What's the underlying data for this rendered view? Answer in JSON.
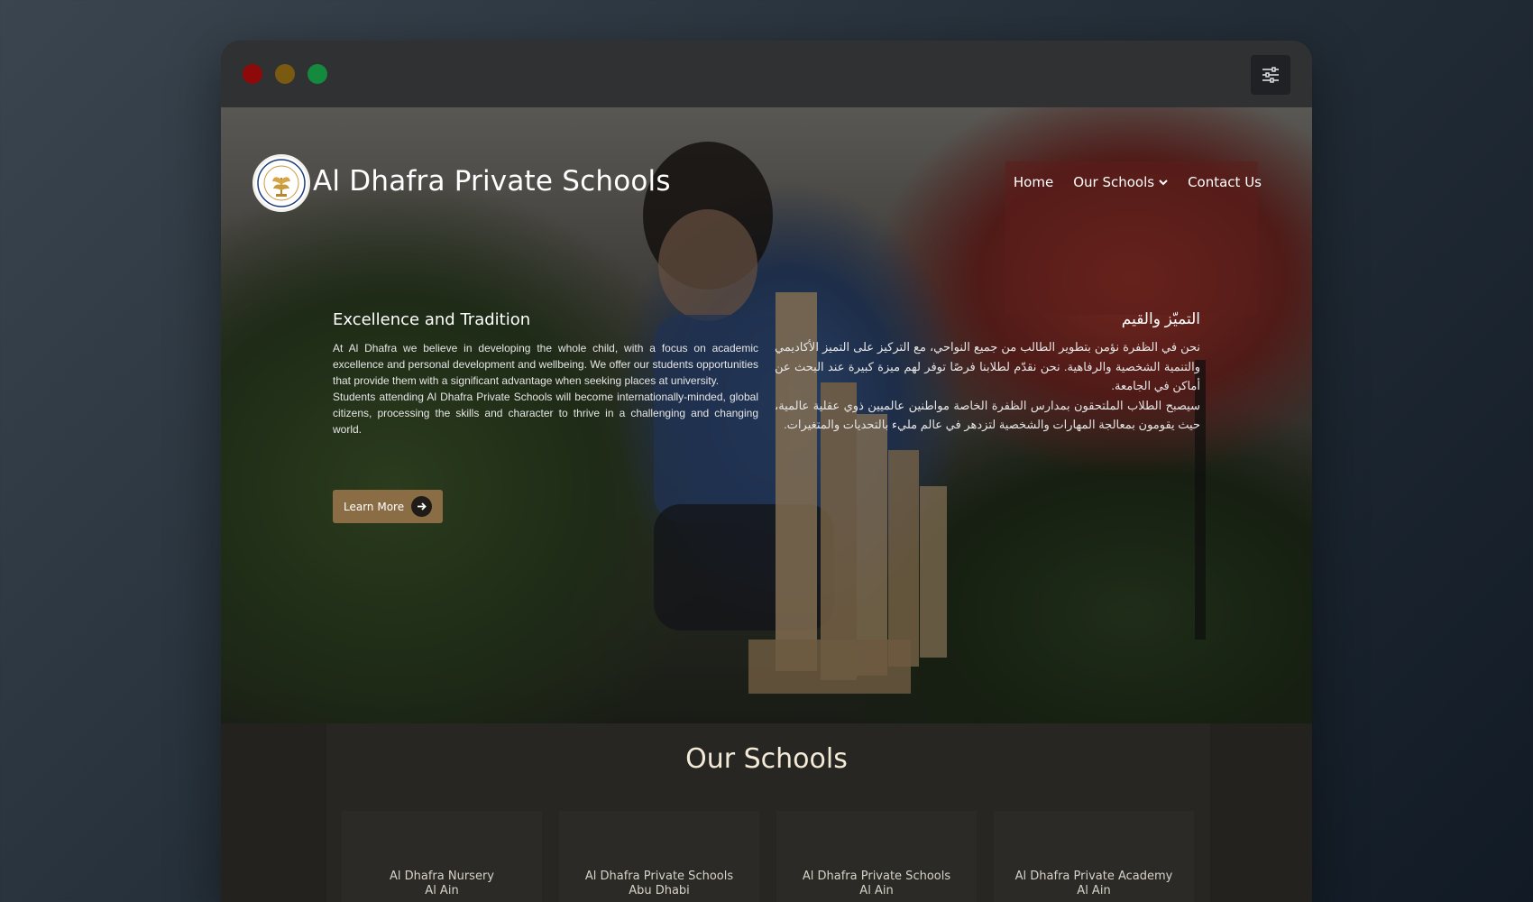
{
  "window": {
    "controls": [
      "close",
      "minimize",
      "maximize"
    ],
    "settings_icon": "sliders-icon"
  },
  "header": {
    "site_title": "Al Dhafra Private Schools",
    "logo_icon": "school-crest-logo",
    "nav": [
      {
        "label": "Home"
      },
      {
        "label": "Our Schools",
        "icon": "chevron-down-icon"
      },
      {
        "label": "Contact Us"
      }
    ]
  },
  "hero": {
    "en": {
      "heading": "Excellence and Tradition",
      "para1": "At Al Dhafra we believe in developing the whole child, with a focus on academic excellence and personal development and wellbeing. We offer our students opportunities that provide them with a significant advantage when seeking places at university.",
      "para2": "Students attending Al Dhafra Private Schools will become internationally-minded, global citizens, processing the skills and character to thrive in a challenging and changing world."
    },
    "ar": {
      "heading": "التميّز والقيم",
      "para1": "نحن في الظفرة نؤمن بتطوير الطالب من جميع النواحي، مع التركيز على التميز الأكاديمي والتنمية الشخصية والرفاهية. نحن نقدّم لطلابنا فرصًا توفر لهم ميزة كبيرة عند البحث عن أماكن في الجامعة.",
      "para2": "سيصبح الطلاب الملتحقون بمدارس الظفرة الخاصة مواطنين عالميين ذوي عقلية عالمية، حيث يقومون بمعالجة المهارات والشخصية لتزدهر في عالم مليء بالتحديات والمتغيرات."
    },
    "button": {
      "label": "Learn More",
      "icon": "arrow-right-icon"
    }
  },
  "schools": {
    "title": "Our Schools",
    "cards": [
      {
        "name": "Al Dhafra Nursery",
        "city": "Al Ain"
      },
      {
        "name": "Al Dhafra Private Schools",
        "city": "Abu Dhabi"
      },
      {
        "name": "Al Dhafra Private Schools",
        "city": "Al Ain"
      },
      {
        "name": "Al Dhafra Private Academy",
        "city": "Al Ain"
      }
    ]
  },
  "colors": {
    "accent": "#8b6d45",
    "close": "#8e0a0a",
    "minimize": "#7a5a10",
    "maximize": "#138a3d"
  }
}
